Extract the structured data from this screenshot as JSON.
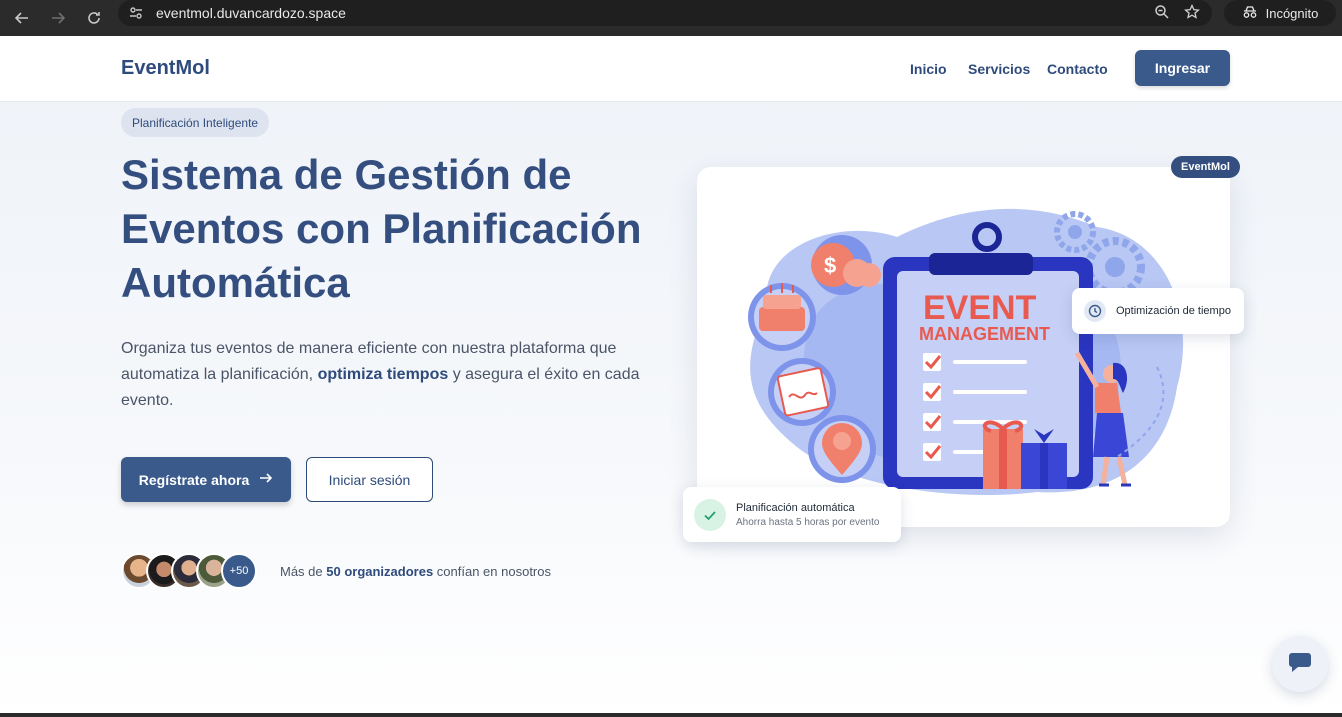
{
  "browser": {
    "url": "eventmol.duvancardozo.space",
    "incognito_label": "Incógnito"
  },
  "header": {
    "logo": "EventMol",
    "nav": [
      "Inicio",
      "Servicios",
      "Contacto"
    ],
    "login_button": "Ingresar"
  },
  "hero": {
    "badge": "Planificación Inteligente",
    "title": "Sistema de Gestión de Eventos con Planificación Automática",
    "desc_part1": "Organiza tus eventos de manera eficiente con nuestra plataforma que automatiza la planificación, ",
    "desc_strong": "optimiza tiempos",
    "desc_part2": " y asegura el éxito en cada evento.",
    "primary_button": "Regístrate ahora",
    "secondary_button": "Iniciar sesión",
    "avatar_count": "+50",
    "trust_prefix": "Más de ",
    "trust_strong": "50 organizadores",
    "trust_suffix": " confían en nosotros"
  },
  "illustration": {
    "tag": "EventMol",
    "clipboard_line1": "EVENT",
    "clipboard_line2": "MANAGEMENT",
    "chip_time": "Optimización de tiempo",
    "chip_plan_title": "Planificación automática",
    "chip_plan_sub": "Ahorra hasta 5 horas por evento"
  },
  "colors": {
    "brand": "#344f7f",
    "button": "#3a5a8c",
    "accent_red": "#e85a4f",
    "accent_blue": "#3440c8"
  }
}
